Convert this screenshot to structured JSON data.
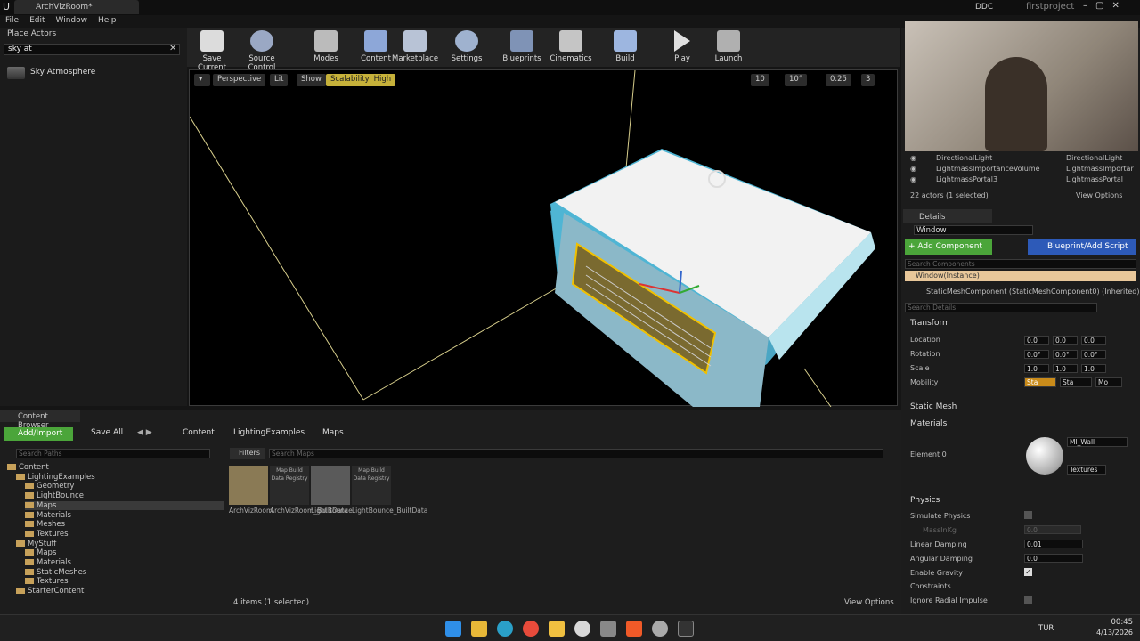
{
  "app": {
    "tab_title": "ArchVizRoom*",
    "project": "firstproject",
    "ddc": "DDC"
  },
  "menu": [
    "File",
    "Edit",
    "Window",
    "Help"
  ],
  "place_actors": {
    "title": "Place Actors",
    "search_value": "sky at",
    "result": "Sky Atmosphere"
  },
  "toolbar": [
    "Save Current",
    "Source Control",
    "Modes",
    "Content",
    "Marketplace",
    "Settings",
    "Blueprints",
    "Cinematics",
    "Build",
    "Play",
    "Launch"
  ],
  "viewport": {
    "perspective": "Perspective",
    "lit": "Lit",
    "show": "Show",
    "scalability": "Scalability: High",
    "grid": "10",
    "angle": "10°",
    "scale": "0.25",
    "cam": "3"
  },
  "outliner": {
    "items": [
      {
        "name": "DirectionalLight",
        "type": "DirectionalLight"
      },
      {
        "name": "LightmassImportanceVolume",
        "type": "LightmassImportar"
      },
      {
        "name": "LightmassPortal3",
        "type": "LightmassPortal"
      }
    ],
    "count": "22 actors (1 selected)",
    "view_options": "View Options"
  },
  "details": {
    "tab": "Details",
    "name_value": "Window",
    "add_component": "+ Add Component",
    "blueprint": "Blueprint/Add Script",
    "search_components": "Search Components",
    "instance": "Window(Instance)",
    "component": "StaticMeshComponent (StaticMeshComponent0) (Inherited)",
    "search_details": "Search Details",
    "transform": "Transform",
    "location": "Location",
    "rotation": "Rotation",
    "scale": "Scale",
    "mobility": "Mobility",
    "mob_opts": [
      "Sta",
      "Sta",
      "Mo"
    ],
    "loc": [
      "0.0",
      "0.0",
      "0.0"
    ],
    "rot": [
      "0.0°",
      "0.0°",
      "0.0°"
    ],
    "scl": [
      "1.0",
      "1.0",
      "1.0"
    ],
    "static_mesh": "Static Mesh",
    "materials": "Materials",
    "element0": "Element 0",
    "material": "MI_Wall",
    "textures": "Textures",
    "physics": "Physics",
    "simulate": "Simulate Physics",
    "mass": "MassInKg",
    "mass_val": "0.0",
    "lin": "Linear Damping",
    "lin_val": "0.01",
    "ang": "Angular Damping",
    "ang_val": "0.0",
    "gravity": "Enable Gravity",
    "constraints": "Constraints",
    "radial": "Ignore Radial Impulse"
  },
  "content_browser": {
    "title": "Content Browser",
    "add_import": "Add/Import",
    "save_all": "Save All",
    "crumbs": [
      "Content",
      "LightingExamples",
      "Maps"
    ],
    "search_paths": "Search Paths",
    "filters": "Filters",
    "search_maps": "Search Maps",
    "status": "4 items (1 selected)",
    "view_options": "View Options",
    "tree": [
      {
        "label": "Content",
        "indent": 0
      },
      {
        "label": "LightingExamples",
        "indent": 1
      },
      {
        "label": "Geometry",
        "indent": 2
      },
      {
        "label": "LightBounce",
        "indent": 2
      },
      {
        "label": "Maps",
        "indent": 2
      },
      {
        "label": "Materials",
        "indent": 2
      },
      {
        "label": "Meshes",
        "indent": 2
      },
      {
        "label": "Textures",
        "indent": 2
      },
      {
        "label": "MyStuff",
        "indent": 1
      },
      {
        "label": "Maps",
        "indent": 2
      },
      {
        "label": "Materials",
        "indent": 2
      },
      {
        "label": "StaticMeshes",
        "indent": 2
      },
      {
        "label": "Textures",
        "indent": 2
      },
      {
        "label": "StarterContent",
        "indent": 1
      }
    ],
    "assets": [
      {
        "name": "ArchVizRoom",
        "thumb": "map"
      },
      {
        "name": "ArchVizRoom_BuiltData",
        "thumb": "Map Build Data Registry"
      },
      {
        "name": "LightBounce",
        "thumb": "map"
      },
      {
        "name": "LightBounce_BuiltData",
        "thumb": "Map Build Data Registry"
      }
    ]
  },
  "system": {
    "lang": "TUR",
    "time": "00:45",
    "date": "4/13/2026"
  }
}
